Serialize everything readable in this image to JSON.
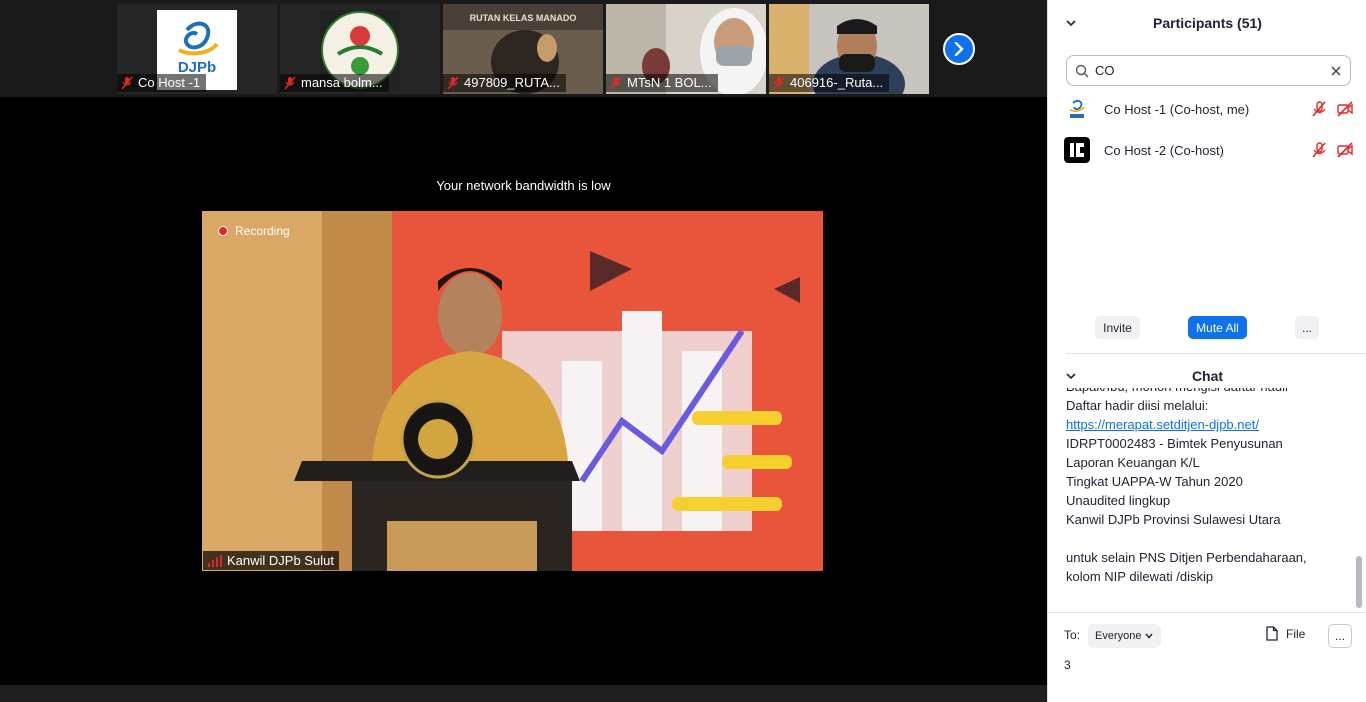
{
  "thumbnails": [
    {
      "name": "Co Host -1",
      "image": "djpb-logo"
    },
    {
      "name": "mansa bolm...",
      "image": "mansa-logo"
    },
    {
      "name": "497809_RUTA...",
      "image": "camera-feed"
    },
    {
      "name": "MTsN 1 BOL...",
      "image": "camera-feed"
    },
    {
      "name": "406916-_Ruta...",
      "image": "camera-feed"
    }
  ],
  "thumb_logo_texts": {
    "djpb": "DJPb",
    "rutan_banner": "RUTAN KELAS MANADO"
  },
  "main": {
    "bandwidth_message": "Your network bandwidth is low",
    "recording_label": "Recording",
    "speaker_name": "Kanwil DJPb Sulut"
  },
  "participants": {
    "title": "Participants (51)",
    "search_value": "CO",
    "list": [
      {
        "name": "Co Host -1 (Co-host, me)",
        "avatar": "djpb-logo"
      },
      {
        "name": "Co Host -2 (Co-host)",
        "avatar": "black-logo"
      }
    ],
    "invite_label": "Invite",
    "mute_all_label": "Mute All",
    "more_label": "..."
  },
  "chat": {
    "title": "Chat",
    "lines": [
      "Bapak/Ibu, mohon mengisi daftar hadir",
      "Daftar hadir diisi melalui:",
      "https://merapat.setditjen-djpb.net/",
      "IDRPT0002483 - Bimtek Penyusunan",
      "Laporan Keuangan K/L",
      "Tingkat UAPPA-W Tahun 2020",
      "Unaudited lingkup",
      "Kanwil DJPb Provinsi Sulawesi Utara",
      "",
      "untuk selain PNS Ditjen Perbendaharaan,",
      "kolom NIP dilewati /diskip"
    ],
    "to_label": "To:",
    "recipient": "Everyone",
    "file_label": "File",
    "more_label": "...",
    "input_value": "3"
  },
  "colors": {
    "accent": "#0e72ed",
    "muted_red": "#e02828",
    "video_bg": "#e8553a"
  }
}
